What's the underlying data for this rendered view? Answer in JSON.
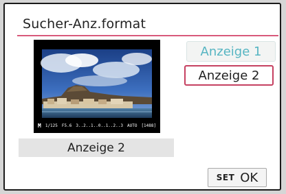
{
  "title": "Sucher-Anz.format",
  "preview": {
    "mode": "M",
    "shutter": "1/125",
    "aperture": "F5.6",
    "exposure_scale": "3..2..1..0..1..2..3",
    "iso": "AUTO",
    "shots": "[1488]",
    "caption": "Anzeige 2"
  },
  "options": [
    {
      "label": "Anzeige 1",
      "selected": false
    },
    {
      "label": "Anzeige 2",
      "selected": true
    }
  ],
  "set_button": {
    "set": "SET",
    "ok": "OK"
  },
  "colors": {
    "accent": "#c54060",
    "title_line": "#d8587a",
    "inactive_text": "#56b5c2"
  }
}
